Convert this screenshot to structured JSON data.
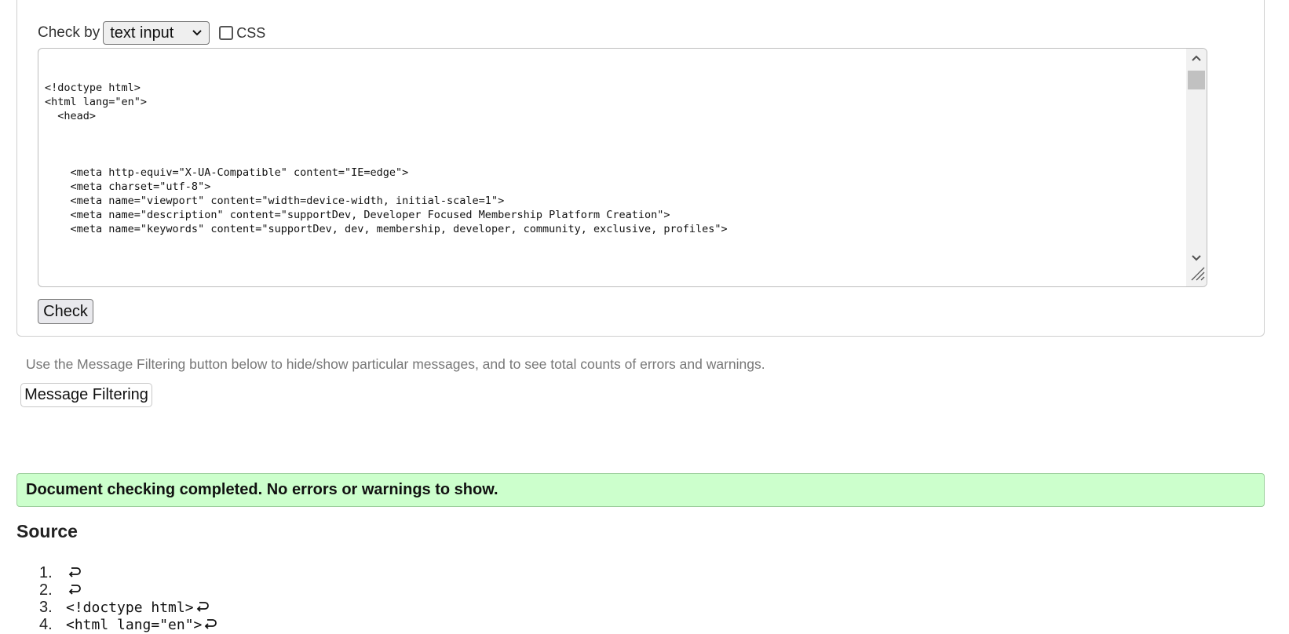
{
  "form": {
    "check_by_label": "Check by",
    "check_by_value": "text input",
    "css_label": "CSS",
    "css_checked": false,
    "textarea_content": "<!doctype html>\n<html lang=\"en\">\n  <head>\n\n\n\n    <meta http-equiv=\"X-UA-Compatible\" content=\"IE=edge\">\n    <meta charset=\"utf-8\">\n    <meta name=\"viewport\" content=\"width=device-width, initial-scale=1\">\n    <meta name=\"description\" content=\"supportDev, Developer Focused Membership Platform Creation\">\n    <meta name=\"keywords\" content=\"supportDev, dev, membership, developer, community, exclusive, profiles\">",
    "check_button": "Check"
  },
  "filtering": {
    "hint": "Use the Message Filtering button below to hide/show particular messages, and to see total counts of errors and warnings.",
    "button": "Message Filtering"
  },
  "result": {
    "message": "Document checking completed. No errors or warnings to show."
  },
  "source": {
    "heading": "Source",
    "lines": [
      {
        "num": "1.",
        "text": ""
      },
      {
        "num": "2.",
        "text": ""
      },
      {
        "num": "3.",
        "text": "<!doctype html>"
      },
      {
        "num": "4.",
        "text": "<html lang=\"en\">"
      }
    ]
  },
  "icons": {
    "select_arrow": "chevron-down-icon",
    "line_break": "return-arrow-icon"
  },
  "colors": {
    "success_bg": "#ccffcc",
    "success_border": "#9ccf9c",
    "hint_text": "#777777"
  }
}
